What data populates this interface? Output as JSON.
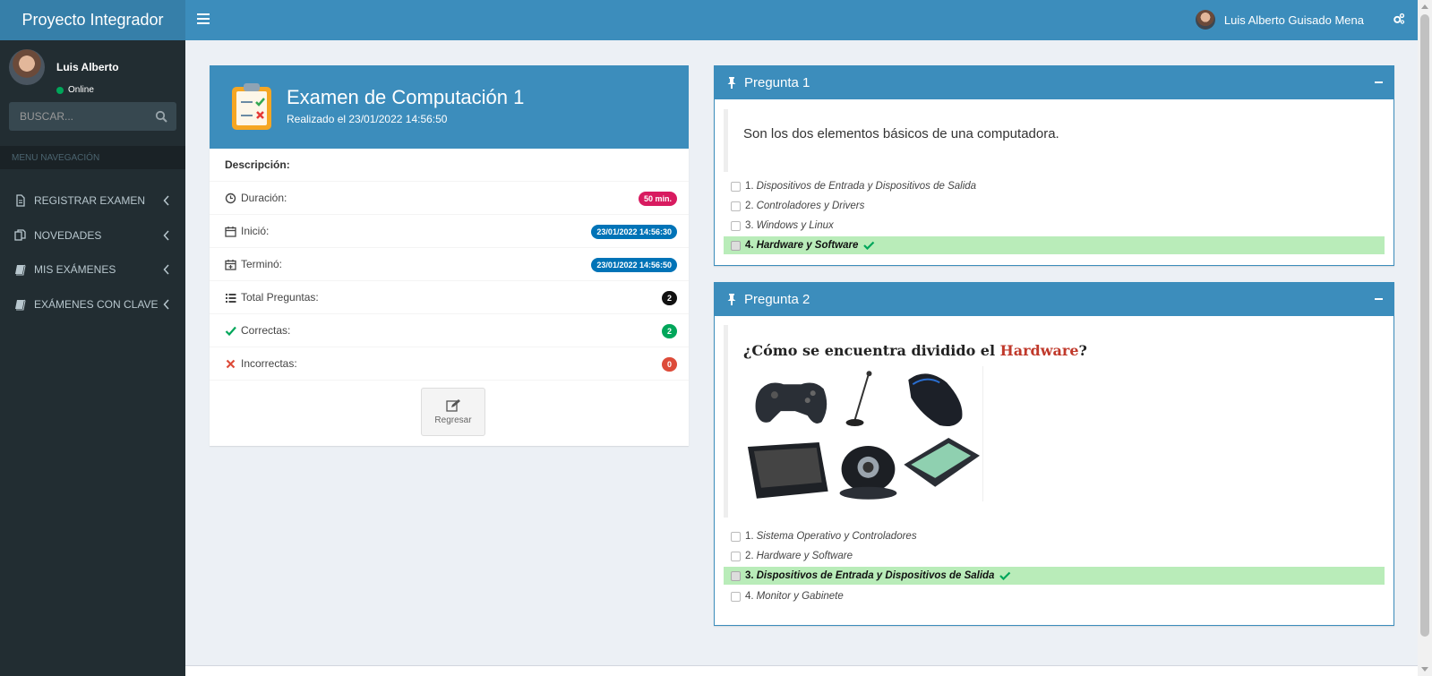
{
  "app": {
    "title": "Proyecto Integrador"
  },
  "header": {
    "user_name": "Luis Alberto Guisado Mena"
  },
  "sidebar": {
    "user": {
      "name": "Luis Alberto",
      "status": "Online"
    },
    "search": {
      "placeholder": "BUSCAR..."
    },
    "menu_header": "MENU NAVEGACIÓN",
    "items": [
      {
        "label": "REGISTRAR EXAMEN",
        "icon": "file-icon"
      },
      {
        "label": "NOVEDADES",
        "icon": "copy-icon"
      },
      {
        "label": "MIS EXÁMENES",
        "icon": "book-icon"
      },
      {
        "label": "EXÁMENES CON CLAVE",
        "icon": "book-icon"
      }
    ]
  },
  "exam": {
    "title": "Examen de Computación 1",
    "subtitle": "Realizado el 23/01/2022 14:56:50",
    "description_label": "Descripción:",
    "rows": [
      {
        "label": "Duración:",
        "value": "50 min.",
        "color": "#d81b60",
        "icon": "clock-icon"
      },
      {
        "label": "Inició:",
        "value": "23/01/2022 14:56:30",
        "color": "#0073b7",
        "icon": "calendar-icon"
      },
      {
        "label": "Terminó:",
        "value": "23/01/2022 14:56:50",
        "color": "#0073b7",
        "icon": "calendar-plus-icon"
      },
      {
        "label": "Total Preguntas:",
        "value": "2",
        "color": "#111111",
        "icon": "list-icon"
      },
      {
        "label": "Correctas:",
        "value": "2",
        "color": "#00a65a",
        "icon": "check-icon"
      },
      {
        "label": "Incorrectas:",
        "value": "0",
        "color": "#dd4b39",
        "icon": "times-icon"
      }
    ],
    "back_label": "Regresar"
  },
  "questions": [
    {
      "title": "Pregunta 1",
      "text": "Son los dos elementos básicos de una computadora.",
      "options": [
        {
          "num": "1.",
          "text": "Dispositivos de Entrada y Dispositivos de Salida",
          "correct": false
        },
        {
          "num": "2.",
          "text": "Controladores y Drivers",
          "correct": false
        },
        {
          "num": "3.",
          "text": "Windows y Linux",
          "correct": false
        },
        {
          "num": "4.",
          "text": "Hardware y Software",
          "correct": true
        }
      ]
    },
    {
      "title": "Pregunta 2",
      "text_before": "¿Cómo se encuentra dividido el ",
      "text_highlight": "Hardware",
      "text_after": "?",
      "image": "hardware-devices-image",
      "options": [
        {
          "num": "1.",
          "text": "Sistema Operativo y Controladores",
          "correct": false
        },
        {
          "num": "2.",
          "text": "Hardware y Software",
          "correct": false
        },
        {
          "num": "3.",
          "text": "Dispositivos de Entrada y Dispositivos de Salida",
          "correct": true
        },
        {
          "num": "4.",
          "text": "Monitor y Gabinete",
          "correct": false
        }
      ]
    }
  ]
}
